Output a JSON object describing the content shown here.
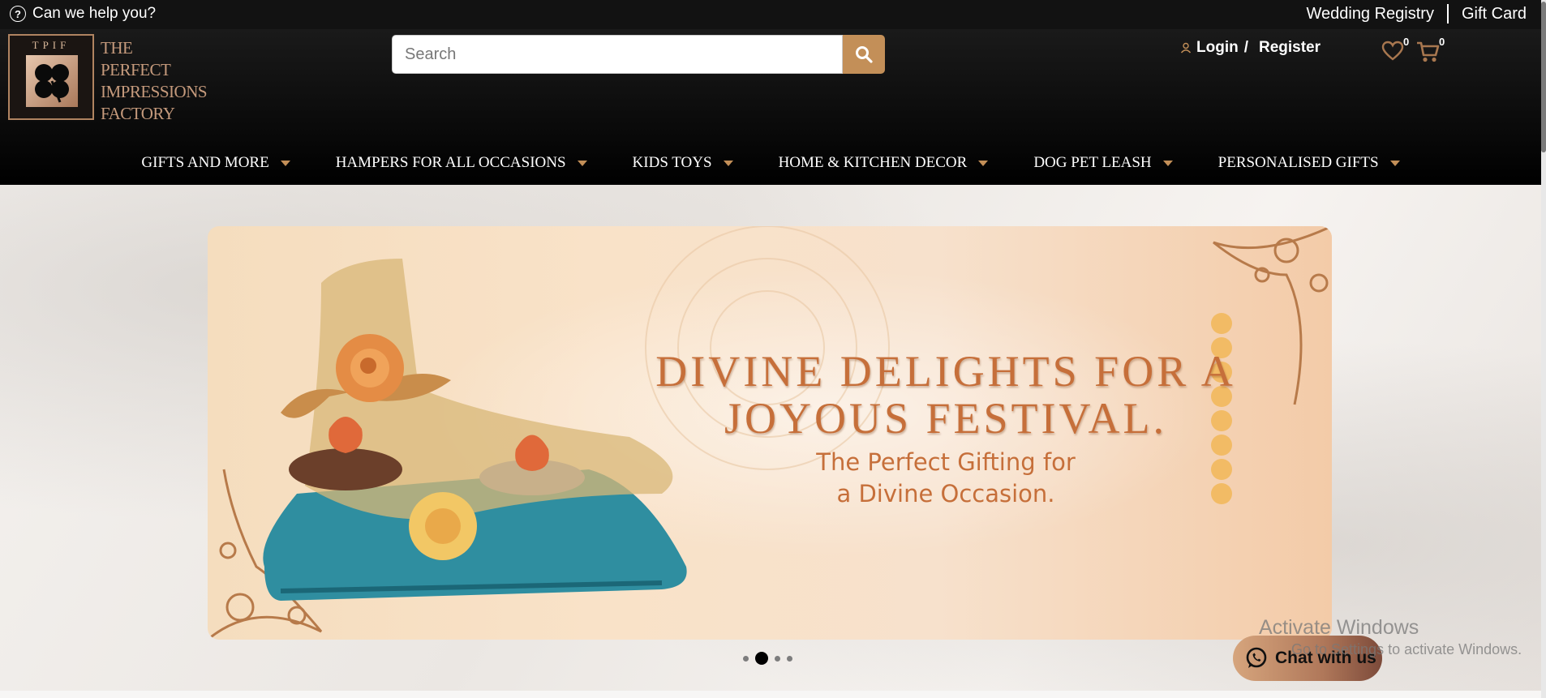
{
  "topbar": {
    "help_text": "Can we help you?",
    "links": [
      "Wedding Registry",
      "Gift Card"
    ]
  },
  "logo": {
    "badge_letters": "TPIF",
    "lines": [
      "THE",
      "PERFECT",
      "IMPRESSIONS",
      "FACTORY"
    ]
  },
  "search": {
    "placeholder": "Search",
    "value": ""
  },
  "account": {
    "login_label": "Login",
    "separator": "/",
    "register_label": "Register"
  },
  "wishlist": {
    "count": "0",
    "icon": "heart-icon"
  },
  "cart": {
    "count": "0",
    "icon": "cart-icon"
  },
  "nav": {
    "items": [
      {
        "label": "GIFTS AND MORE"
      },
      {
        "label": "HAMPERS FOR ALL OCCASIONS"
      },
      {
        "label": "KIDS TOYS"
      },
      {
        "label": "HOME & KITCHEN DECOR"
      },
      {
        "label": "DOG PET LEASH"
      },
      {
        "label": "PERSONALISED GIFTS"
      }
    ]
  },
  "banner": {
    "headline": "DIVINE DELIGHTS FOR A JOYOUS FESTIVAL.",
    "subline_1": "The Perfect Gifting for",
    "subline_2": "a Divine Occasion.",
    "slide_count": 4,
    "active_slide": 2
  },
  "watermark": {
    "line_1": "Activate Windows",
    "line_2": "Go to Settings to activate Windows."
  },
  "chat": {
    "label": "Chat with us"
  },
  "colors": {
    "accent": "#c38f58",
    "header_bg": "#0c0c0c",
    "banner_text": "#c66f3a"
  }
}
